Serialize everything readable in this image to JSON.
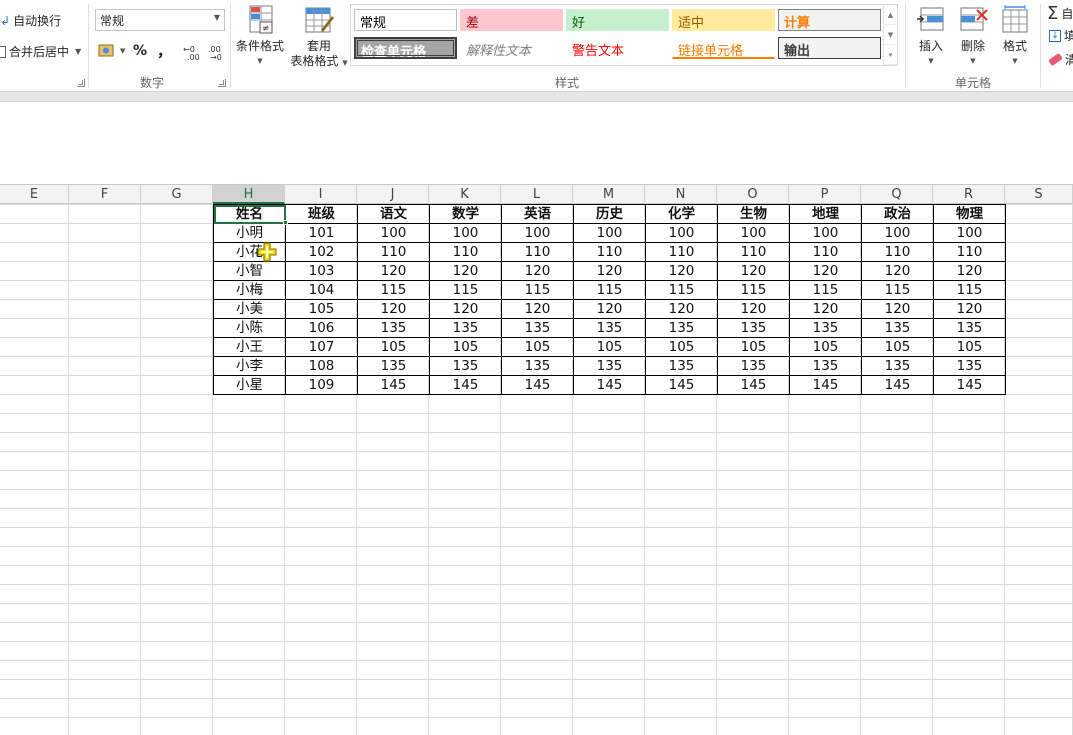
{
  "ribbon": {
    "alignment": {
      "wrap_text": "自动换行",
      "merge_center": "合并后居中"
    },
    "number": {
      "format_value": "常规",
      "percent": "%",
      "comma": "，",
      "group_label": "数字"
    },
    "styles": {
      "conditional_format": "条件格式",
      "table_format_line1": "套用",
      "table_format_line2": "表格格式",
      "group_label": "样式",
      "gallery": [
        {
          "label": "常规",
          "bg": "#ffffff",
          "fg": "#000000",
          "border": "#bfbfbf"
        },
        {
          "label": "差",
          "bg": "#ffc7ce",
          "fg": "#9c0006",
          "border": "#ffc7ce"
        },
        {
          "label": "好",
          "bg": "#c6efce",
          "fg": "#006100",
          "border": "#c6efce"
        },
        {
          "label": "适中",
          "bg": "#ffeb9c",
          "fg": "#9c5700",
          "border": "#ffeb9c"
        },
        {
          "label": "计算",
          "bg": "#f2f2f2",
          "fg": "#fa7d00",
          "border": "#7f7f7f"
        },
        {
          "label": "检查单元格",
          "bg": "#a5a5a5",
          "fg": "#ffffff",
          "border": "#3f3f3f"
        },
        {
          "label": "解释性文本",
          "bg": "#ffffff",
          "fg": "#7f7f7f",
          "border": "#ffffff"
        },
        {
          "label": "警告文本",
          "bg": "#ffffff",
          "fg": "#ff0000",
          "border": "#ffffff"
        },
        {
          "label": "链接单元格",
          "bg": "#ffffff",
          "fg": "#fa7d00",
          "border": "#ffffff"
        },
        {
          "label": "输出",
          "bg": "#f2f2f2",
          "fg": "#3f3f3f",
          "border": "#3f3f3f"
        }
      ]
    },
    "cells": {
      "insert": "插入",
      "delete": "删除",
      "format": "格式",
      "group_label": "单元格"
    },
    "editing": {
      "autosum": "自",
      "fill": "填",
      "clear": "清"
    }
  },
  "sheet": {
    "columns": [
      "E",
      "F",
      "G",
      "H",
      "I",
      "J",
      "K",
      "L",
      "M",
      "N",
      "O",
      "P",
      "Q",
      "R",
      "S"
    ],
    "selected_column": "H",
    "headers": [
      "姓名",
      "班级",
      "语文",
      "数学",
      "英语",
      "历史",
      "化学",
      "生物",
      "地理",
      "政治",
      "物理"
    ],
    "rows": [
      [
        "小明",
        "101",
        "100",
        "100",
        "100",
        "100",
        "100",
        "100",
        "100",
        "100",
        "100"
      ],
      [
        "小花",
        "102",
        "110",
        "110",
        "110",
        "110",
        "110",
        "110",
        "110",
        "110",
        "110"
      ],
      [
        "小智",
        "103",
        "120",
        "120",
        "120",
        "120",
        "120",
        "120",
        "120",
        "120",
        "120"
      ],
      [
        "小梅",
        "104",
        "115",
        "115",
        "115",
        "115",
        "115",
        "115",
        "115",
        "115",
        "115"
      ],
      [
        "小美",
        "105",
        "120",
        "120",
        "120",
        "120",
        "120",
        "120",
        "120",
        "120",
        "120"
      ],
      [
        "小陈",
        "106",
        "135",
        "135",
        "135",
        "135",
        "135",
        "135",
        "135",
        "135",
        "135"
      ],
      [
        "小王",
        "107",
        "105",
        "105",
        "105",
        "105",
        "105",
        "105",
        "105",
        "105",
        "105"
      ],
      [
        "小李",
        "108",
        "135",
        "135",
        "135",
        "135",
        "135",
        "135",
        "135",
        "135",
        "135"
      ],
      [
        "小星",
        "109",
        "145",
        "145",
        "145",
        "145",
        "145",
        "145",
        "145",
        "145",
        "145"
      ]
    ]
  },
  "colors": {
    "accent_green": "#217346",
    "cursor_yellow": "#f5d800"
  }
}
